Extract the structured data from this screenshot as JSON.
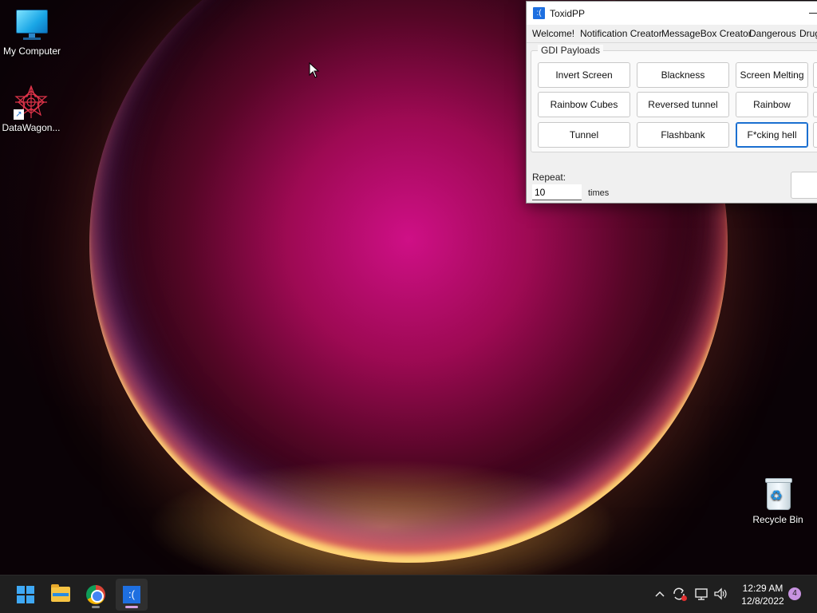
{
  "desktop": {
    "icons": [
      {
        "label": "My Computer",
        "icon": "monitor-icon"
      },
      {
        "label": "DataWagon...",
        "icon": "datawagon-icon"
      },
      {
        "label": "Recycle Bin",
        "icon": "recycle-bin-icon"
      }
    ]
  },
  "window": {
    "title": "ToxidPP",
    "app_icon_glyph": ":(",
    "tabs": [
      "Welcome!",
      "Notification Creator",
      "MessageBox Creator",
      "Dangerous",
      "Drug"
    ],
    "group_title": "GDI Payloads",
    "buttons": [
      [
        "Invert Screen",
        "Blackness",
        "Screen Melting"
      ],
      [
        "Rainbow Cubes",
        "Reversed tunnel",
        "Rainbow"
      ],
      [
        "Tunnel",
        "Flashbank",
        "F*cking hell"
      ]
    ],
    "repeat_label": "Repeat:",
    "repeat_value": "10",
    "times_label": "times"
  },
  "taskbar": {
    "apps": [
      "start-icon",
      "file-explorer-icon",
      "chrome-icon",
      "toxidpp-icon"
    ],
    "clock_time": "12:29 AM",
    "clock_date": "12/8/2022",
    "notification_count": "4"
  },
  "colors": {
    "accent": "#1a6fd0",
    "taskbar": "#1f1f1f",
    "window_bg": "#f0f0f0"
  }
}
